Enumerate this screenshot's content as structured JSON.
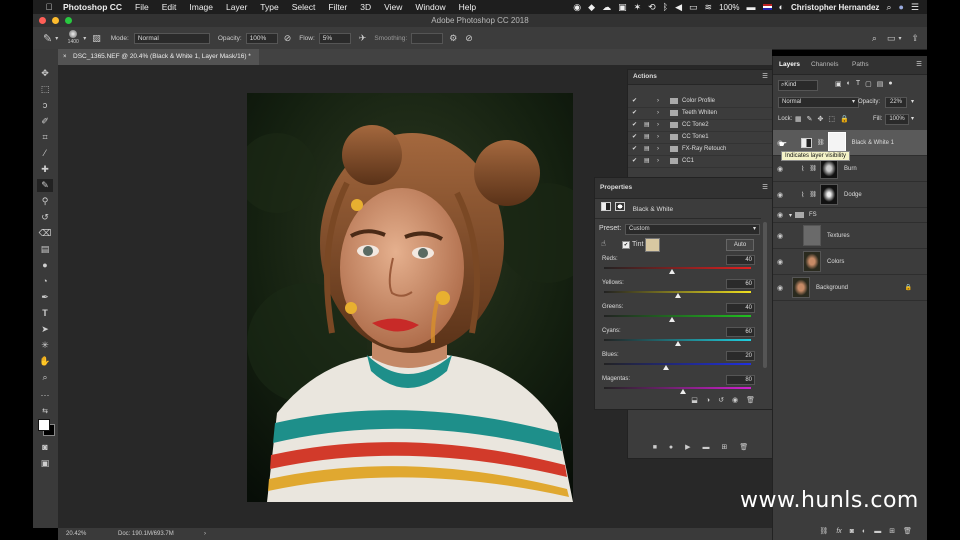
{
  "menubar": {
    "app": "Photoshop CC",
    "items": [
      "File",
      "Edit",
      "Image",
      "Layer",
      "Type",
      "Select",
      "Filter",
      "3D",
      "View",
      "Window",
      "Help"
    ],
    "battery": "100%",
    "user": "Christopher Hernandez"
  },
  "titlebar": {
    "title": "Adobe Photoshop CC 2018"
  },
  "options": {
    "brush_size": "1400",
    "mode_label": "Mode:",
    "mode_value": "Normal",
    "opacity_label": "Opacity:",
    "opacity_value": "100%",
    "flow_label": "Flow:",
    "flow_value": "5%",
    "smoothing_label": "Smoothing:"
  },
  "document": {
    "tab": "DSC_1365.NEF @ 20.4% (Black & White 1, Layer Mask/16) *"
  },
  "status": {
    "zoom": "20.42%",
    "doc": "Doc: 190.1M/693.7M"
  },
  "actions": {
    "title": "Actions",
    "items": [
      {
        "label": "Color Profile"
      },
      {
        "label": "Teeth Whiten"
      },
      {
        "label": "CC Tone2"
      },
      {
        "label": "CC Tone1"
      },
      {
        "label": "FX-Ray Retouch"
      },
      {
        "label": "CC1"
      }
    ]
  },
  "properties": {
    "title": "Properties",
    "adjustment": "Black & White",
    "preset_label": "Preset:",
    "preset_value": "Custom",
    "tint_label": "Tint",
    "auto_label": "Auto",
    "tint_color": "#d8c8a2",
    "sliders": [
      {
        "label": "Reds:",
        "value": "40",
        "level": 0.46,
        "gradient": "linear-gradient(90deg,#222,#e02020)"
      },
      {
        "label": "Yellows:",
        "value": "60",
        "level": 0.5,
        "gradient": "linear-gradient(90deg,#222,#f0e020)"
      },
      {
        "label": "Greens:",
        "value": "40",
        "level": 0.46,
        "gradient": "linear-gradient(90deg,#222,#20c020)"
      },
      {
        "label": "Cyans:",
        "value": "60",
        "level": 0.5,
        "gradient": "linear-gradient(90deg,#222,#20d0e0)"
      },
      {
        "label": "Blues:",
        "value": "20",
        "level": 0.42,
        "gradient": "linear-gradient(90deg,#222,#2030e0)"
      },
      {
        "label": "Magentas:",
        "value": "80",
        "level": 0.54,
        "gradient": "linear-gradient(90deg,#222,#d020d0)"
      }
    ]
  },
  "layers": {
    "tabs": [
      "Layers",
      "Channels",
      "Paths"
    ],
    "kind_label": "Kind",
    "blend_mode": "Normal",
    "opacity_label": "Opacity:",
    "opacity_value": "22%",
    "lock_label": "Lock:",
    "fill_label": "Fill:",
    "fill_value": "100%",
    "tooltip": "Indicates layer visibility",
    "items": [
      {
        "name": "Black & White 1"
      },
      {
        "name": "Burn"
      },
      {
        "name": "Dodge"
      },
      {
        "name": "FS"
      },
      {
        "name": "Textures"
      },
      {
        "name": "Colors"
      },
      {
        "name": "Background"
      }
    ]
  },
  "watermark": "www.hunls.com"
}
